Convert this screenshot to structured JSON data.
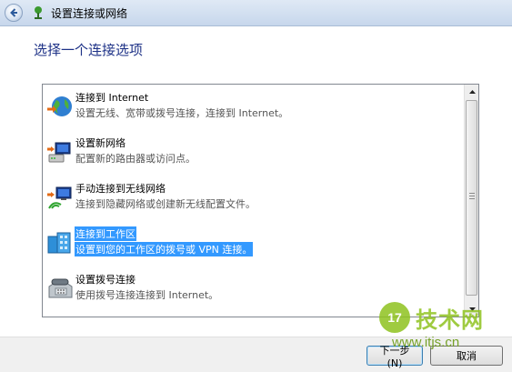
{
  "window": {
    "title": "设置连接或网络",
    "heading": "选择一个连接选项"
  },
  "options": [
    {
      "title": "连接到 Internet",
      "description": "设置无线、宽带或拨号连接，连接到 Internet。",
      "icon": "globe-icon"
    },
    {
      "title": "设置新网络",
      "description": "配置新的路由器或访问点。",
      "icon": "network-router-icon"
    },
    {
      "title": "手动连接到无线网络",
      "description": "连接到隐藏网络或创建新无线配置文件。",
      "icon": "wireless-network-icon"
    },
    {
      "title": "连接到工作区",
      "description": "设置到您的工作区的拨号或 VPN 连接。",
      "icon": "workplace-vpn-icon"
    },
    {
      "title": "设置拨号连接",
      "description": "使用拨号连接连接到 Internet。",
      "icon": "dialup-phone-icon"
    }
  ],
  "selected_option": "连接到工作区",
  "buttons": {
    "next": "下一步(N)",
    "cancel": "取消"
  },
  "watermark": {
    "badge": "17",
    "brand": "技术网",
    "url": "www.itjs.cn"
  },
  "colors": {
    "selection": "#3399ff",
    "heading": "#1e3287",
    "watermark": "#8fc31f"
  }
}
